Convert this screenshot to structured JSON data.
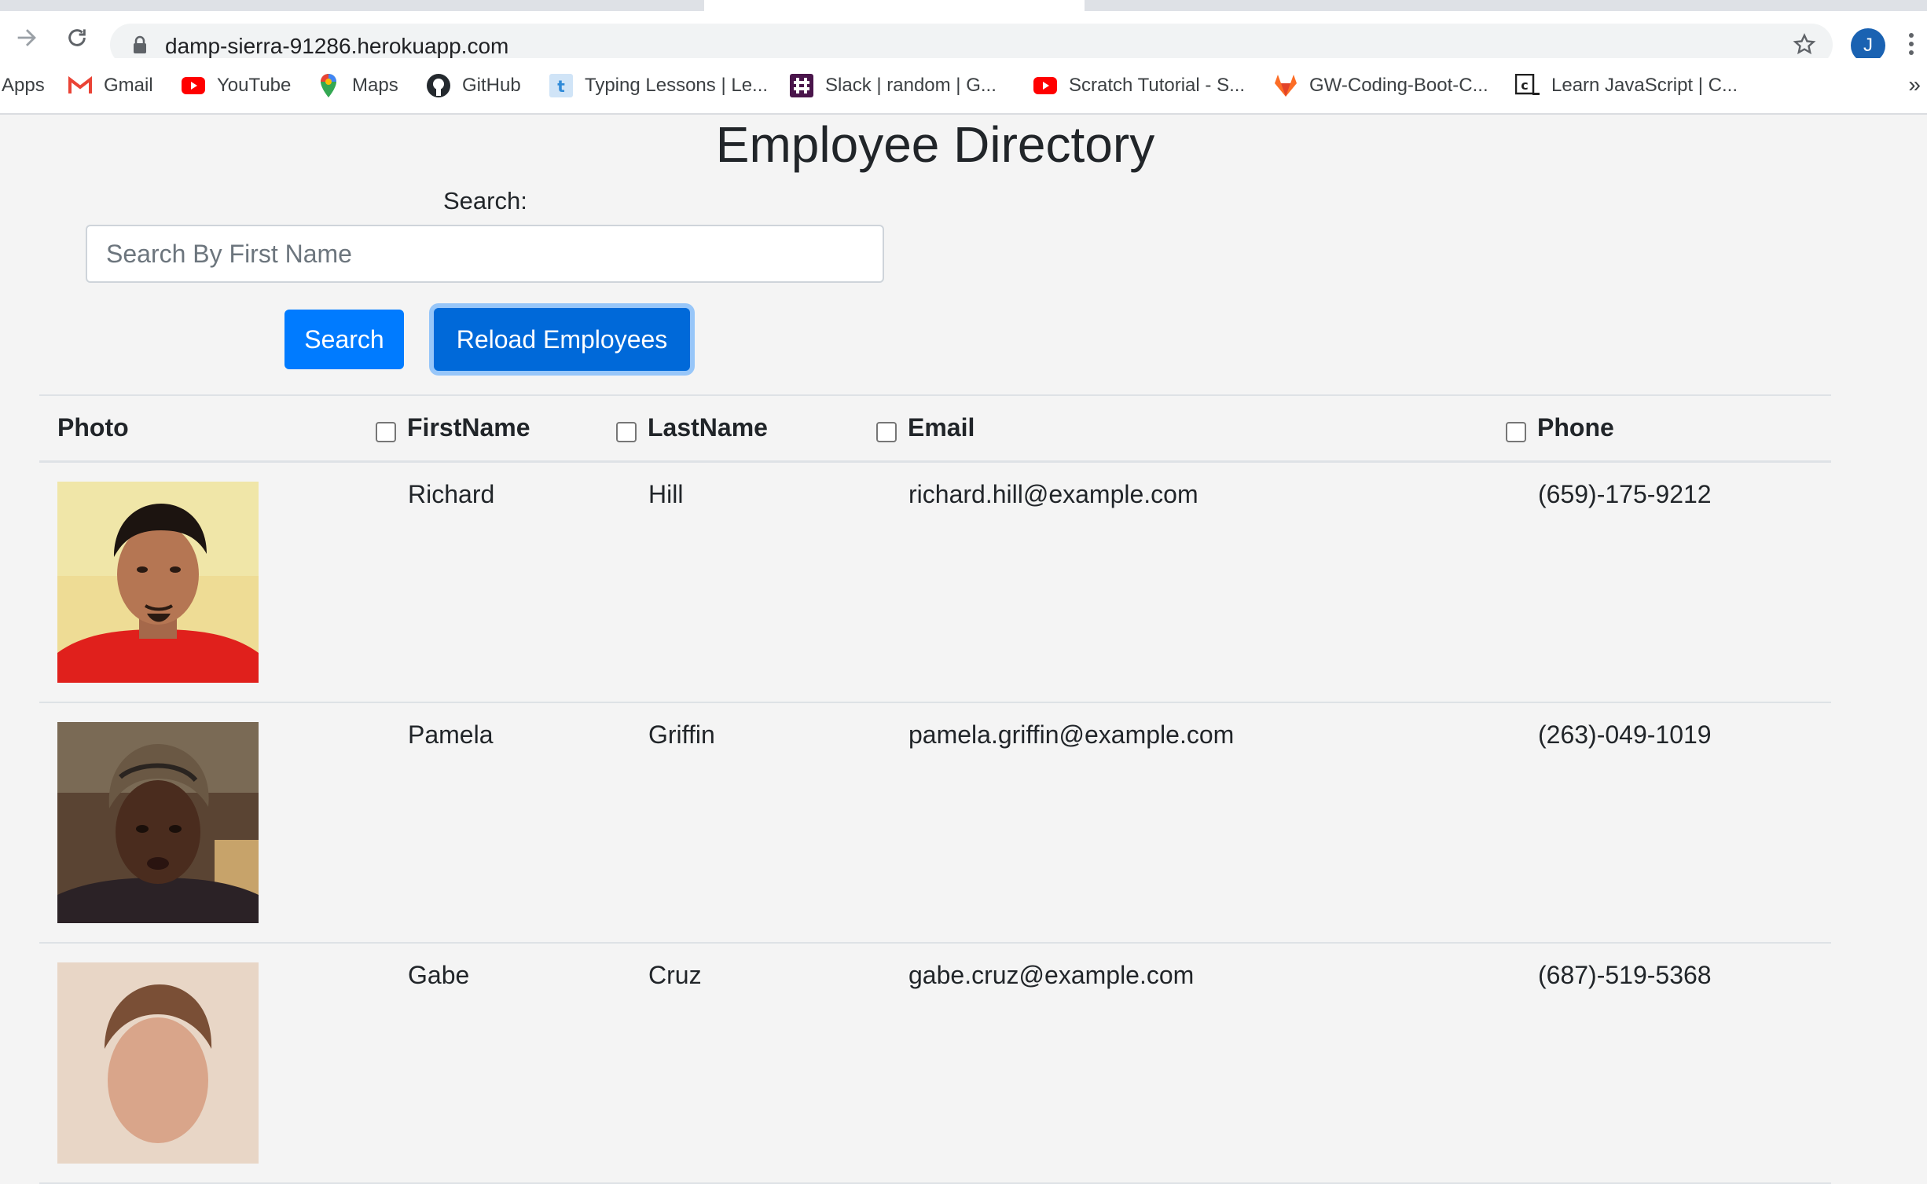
{
  "browser": {
    "url": "damp-sierra-91286.herokuapp.com",
    "profile_initial": "J",
    "bookmarks": [
      {
        "label": "Apps",
        "icon": "apps-icon"
      },
      {
        "label": "Gmail",
        "icon": "gmail-icon"
      },
      {
        "label": "YouTube",
        "icon": "youtube-icon"
      },
      {
        "label": "Maps",
        "icon": "maps-icon"
      },
      {
        "label": "GitHub",
        "icon": "github-icon"
      },
      {
        "label": "Typing Lessons | Le...",
        "icon": "typing-icon"
      },
      {
        "label": "Slack | random | G...",
        "icon": "slack-icon"
      },
      {
        "label": "Scratch Tutorial - S...",
        "icon": "youtube-icon"
      },
      {
        "label": "GW-Coding-Boot-C...",
        "icon": "gitlab-icon"
      },
      {
        "label": "Learn JavaScript | C...",
        "icon": "codecademy-icon"
      }
    ],
    "more": "»"
  },
  "page": {
    "title": "Employee Directory",
    "search_label": "Search:",
    "search_placeholder": "Search By First Name",
    "search_button": "Search",
    "reload_button": "Reload Employees"
  },
  "table": {
    "headers": {
      "photo": "Photo",
      "first": "FirstName",
      "last": "LastName",
      "email": "Email",
      "phone": "Phone"
    },
    "rows": [
      {
        "first": "Richard",
        "last": "Hill",
        "email": "richard.hill@example.com",
        "phone": "(659)-175-9212"
      },
      {
        "first": "Pamela",
        "last": "Griffin",
        "email": "pamela.griffin@example.com",
        "phone": "(263)-049-1019"
      },
      {
        "first": "Gabe",
        "last": "Cruz",
        "email": "gabe.cruz@example.com",
        "phone": "(687)-519-5368"
      }
    ]
  },
  "colors": {
    "primary": "#007bff",
    "primary_active": "#0069d9",
    "page_bg": "#f4f4f4"
  }
}
